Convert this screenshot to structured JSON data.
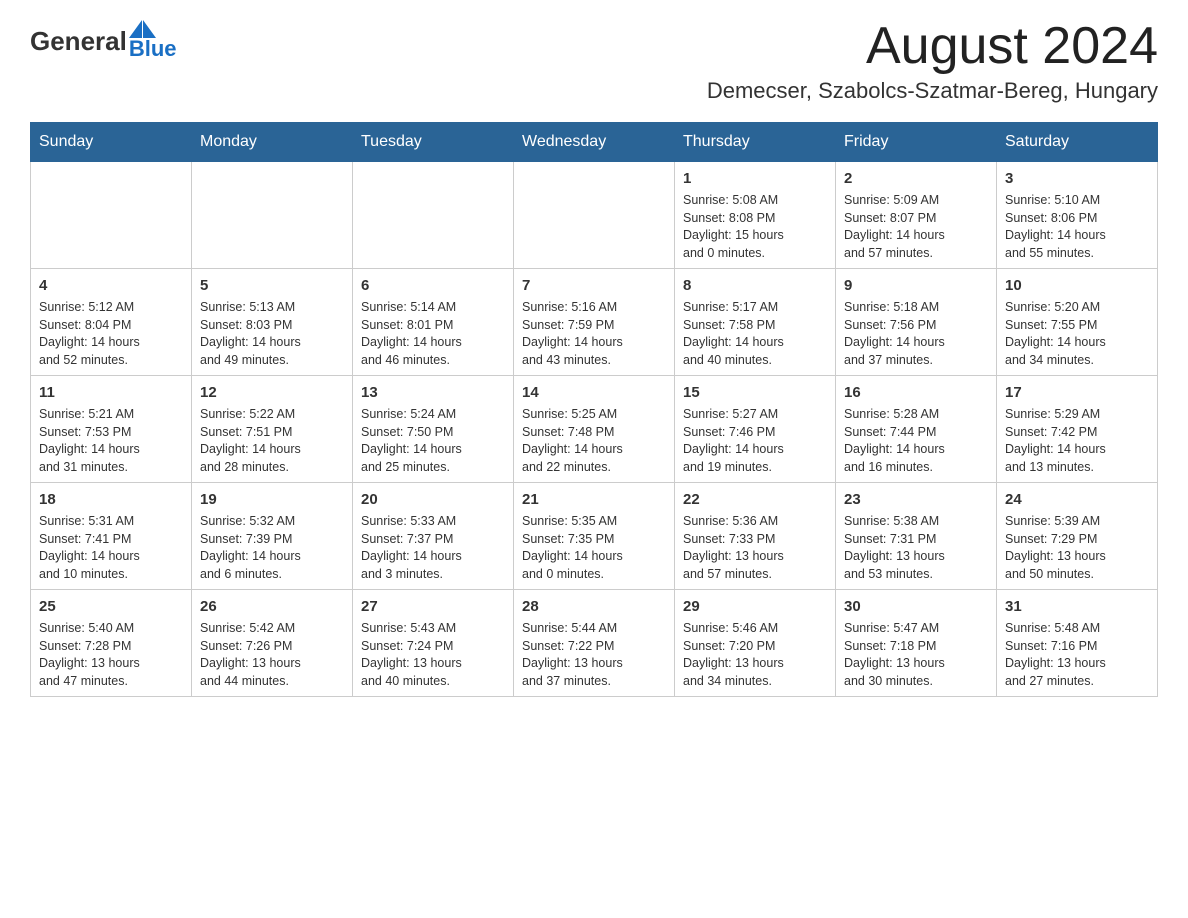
{
  "logo": {
    "text_general": "General",
    "text_blue": "Blue"
  },
  "header": {
    "month_title": "August 2024",
    "location": "Demecser, Szabolcs-Szatmar-Bereg, Hungary"
  },
  "weekdays": [
    "Sunday",
    "Monday",
    "Tuesday",
    "Wednesday",
    "Thursday",
    "Friday",
    "Saturday"
  ],
  "weeks": [
    [
      {
        "day": "",
        "info": ""
      },
      {
        "day": "",
        "info": ""
      },
      {
        "day": "",
        "info": ""
      },
      {
        "day": "",
        "info": ""
      },
      {
        "day": "1",
        "info": "Sunrise: 5:08 AM\nSunset: 8:08 PM\nDaylight: 15 hours\nand 0 minutes."
      },
      {
        "day": "2",
        "info": "Sunrise: 5:09 AM\nSunset: 8:07 PM\nDaylight: 14 hours\nand 57 minutes."
      },
      {
        "day": "3",
        "info": "Sunrise: 5:10 AM\nSunset: 8:06 PM\nDaylight: 14 hours\nand 55 minutes."
      }
    ],
    [
      {
        "day": "4",
        "info": "Sunrise: 5:12 AM\nSunset: 8:04 PM\nDaylight: 14 hours\nand 52 minutes."
      },
      {
        "day": "5",
        "info": "Sunrise: 5:13 AM\nSunset: 8:03 PM\nDaylight: 14 hours\nand 49 minutes."
      },
      {
        "day": "6",
        "info": "Sunrise: 5:14 AM\nSunset: 8:01 PM\nDaylight: 14 hours\nand 46 minutes."
      },
      {
        "day": "7",
        "info": "Sunrise: 5:16 AM\nSunset: 7:59 PM\nDaylight: 14 hours\nand 43 minutes."
      },
      {
        "day": "8",
        "info": "Sunrise: 5:17 AM\nSunset: 7:58 PM\nDaylight: 14 hours\nand 40 minutes."
      },
      {
        "day": "9",
        "info": "Sunrise: 5:18 AM\nSunset: 7:56 PM\nDaylight: 14 hours\nand 37 minutes."
      },
      {
        "day": "10",
        "info": "Sunrise: 5:20 AM\nSunset: 7:55 PM\nDaylight: 14 hours\nand 34 minutes."
      }
    ],
    [
      {
        "day": "11",
        "info": "Sunrise: 5:21 AM\nSunset: 7:53 PM\nDaylight: 14 hours\nand 31 minutes."
      },
      {
        "day": "12",
        "info": "Sunrise: 5:22 AM\nSunset: 7:51 PM\nDaylight: 14 hours\nand 28 minutes."
      },
      {
        "day": "13",
        "info": "Sunrise: 5:24 AM\nSunset: 7:50 PM\nDaylight: 14 hours\nand 25 minutes."
      },
      {
        "day": "14",
        "info": "Sunrise: 5:25 AM\nSunset: 7:48 PM\nDaylight: 14 hours\nand 22 minutes."
      },
      {
        "day": "15",
        "info": "Sunrise: 5:27 AM\nSunset: 7:46 PM\nDaylight: 14 hours\nand 19 minutes."
      },
      {
        "day": "16",
        "info": "Sunrise: 5:28 AM\nSunset: 7:44 PM\nDaylight: 14 hours\nand 16 minutes."
      },
      {
        "day": "17",
        "info": "Sunrise: 5:29 AM\nSunset: 7:42 PM\nDaylight: 14 hours\nand 13 minutes."
      }
    ],
    [
      {
        "day": "18",
        "info": "Sunrise: 5:31 AM\nSunset: 7:41 PM\nDaylight: 14 hours\nand 10 minutes."
      },
      {
        "day": "19",
        "info": "Sunrise: 5:32 AM\nSunset: 7:39 PM\nDaylight: 14 hours\nand 6 minutes."
      },
      {
        "day": "20",
        "info": "Sunrise: 5:33 AM\nSunset: 7:37 PM\nDaylight: 14 hours\nand 3 minutes."
      },
      {
        "day": "21",
        "info": "Sunrise: 5:35 AM\nSunset: 7:35 PM\nDaylight: 14 hours\nand 0 minutes."
      },
      {
        "day": "22",
        "info": "Sunrise: 5:36 AM\nSunset: 7:33 PM\nDaylight: 13 hours\nand 57 minutes."
      },
      {
        "day": "23",
        "info": "Sunrise: 5:38 AM\nSunset: 7:31 PM\nDaylight: 13 hours\nand 53 minutes."
      },
      {
        "day": "24",
        "info": "Sunrise: 5:39 AM\nSunset: 7:29 PM\nDaylight: 13 hours\nand 50 minutes."
      }
    ],
    [
      {
        "day": "25",
        "info": "Sunrise: 5:40 AM\nSunset: 7:28 PM\nDaylight: 13 hours\nand 47 minutes."
      },
      {
        "day": "26",
        "info": "Sunrise: 5:42 AM\nSunset: 7:26 PM\nDaylight: 13 hours\nand 44 minutes."
      },
      {
        "day": "27",
        "info": "Sunrise: 5:43 AM\nSunset: 7:24 PM\nDaylight: 13 hours\nand 40 minutes."
      },
      {
        "day": "28",
        "info": "Sunrise: 5:44 AM\nSunset: 7:22 PM\nDaylight: 13 hours\nand 37 minutes."
      },
      {
        "day": "29",
        "info": "Sunrise: 5:46 AM\nSunset: 7:20 PM\nDaylight: 13 hours\nand 34 minutes."
      },
      {
        "day": "30",
        "info": "Sunrise: 5:47 AM\nSunset: 7:18 PM\nDaylight: 13 hours\nand 30 minutes."
      },
      {
        "day": "31",
        "info": "Sunrise: 5:48 AM\nSunset: 7:16 PM\nDaylight: 13 hours\nand 27 minutes."
      }
    ]
  ]
}
